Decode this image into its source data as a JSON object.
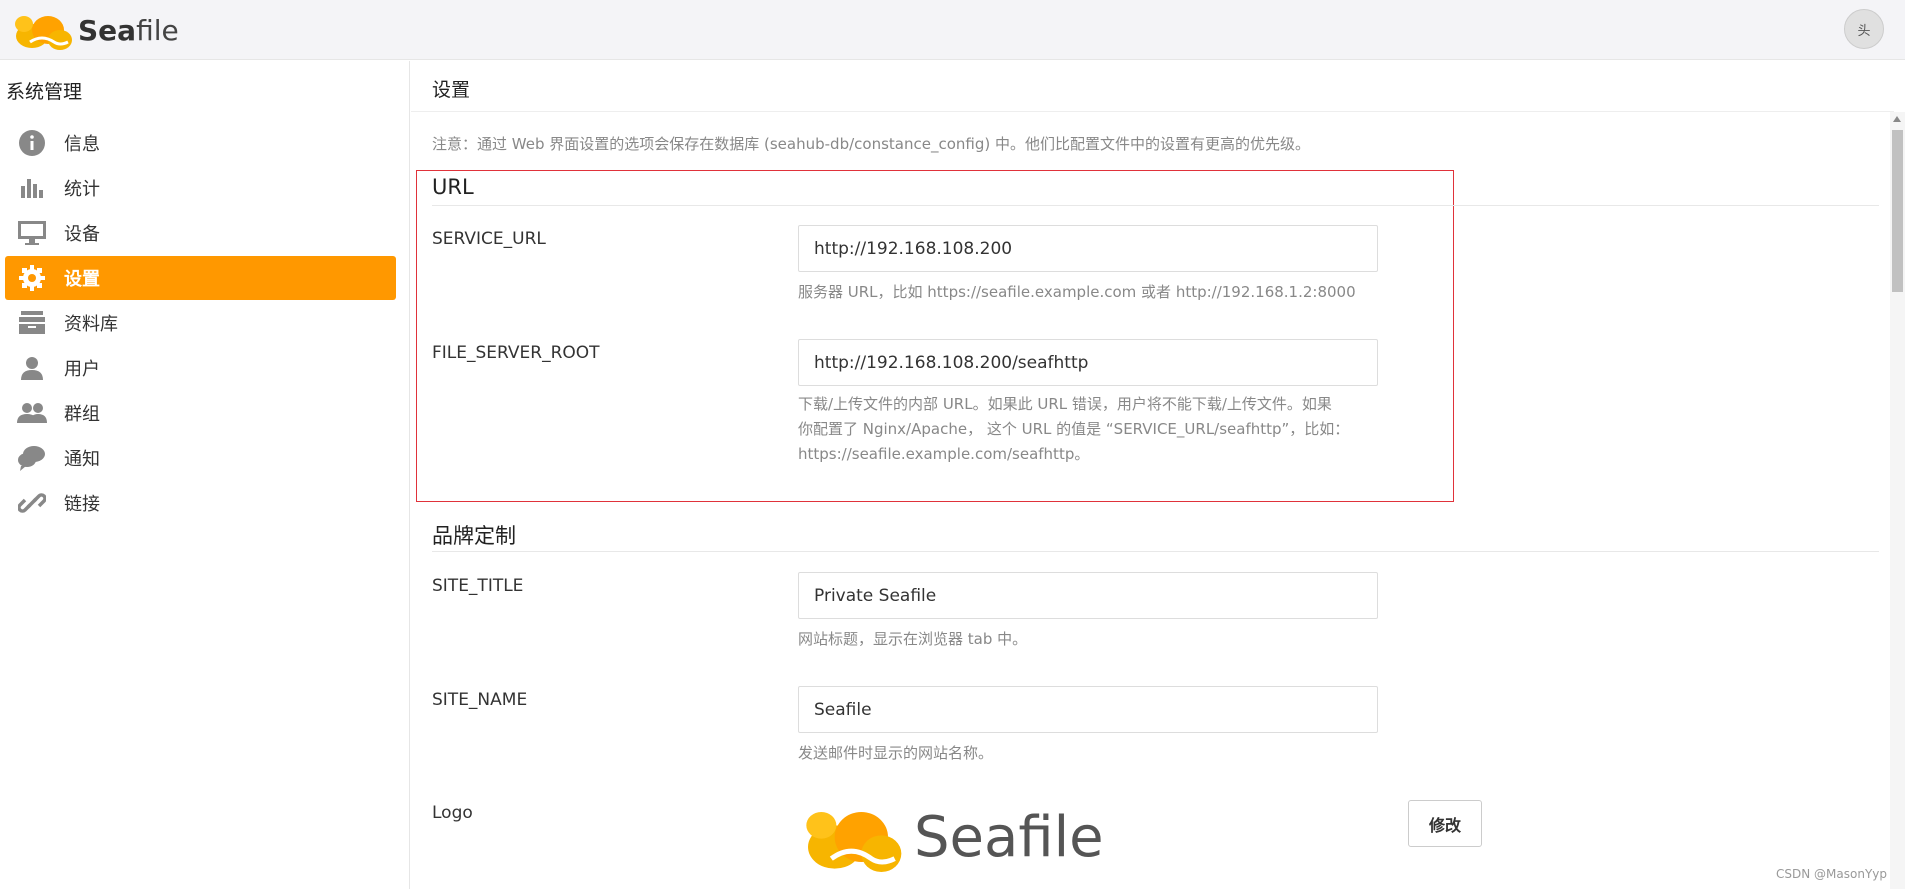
{
  "header": {
    "logo_text_bold": "Sea",
    "logo_text_rest": "file",
    "avatar_alt": "头"
  },
  "sidebar": {
    "heading": "系统管理",
    "items": [
      {
        "label": "信息",
        "icon": "info-icon"
      },
      {
        "label": "统计",
        "icon": "bar-chart-icon"
      },
      {
        "label": "设备",
        "icon": "monitor-icon"
      },
      {
        "label": "设置",
        "icon": "gear-icon",
        "active": true
      },
      {
        "label": "资料库",
        "icon": "archive-icon"
      },
      {
        "label": "用户",
        "icon": "user-icon"
      },
      {
        "label": "群组",
        "icon": "group-icon"
      },
      {
        "label": "通知",
        "icon": "chat-icon"
      },
      {
        "label": "链接",
        "icon": "link-icon"
      }
    ]
  },
  "main": {
    "title": "设置",
    "note": "注意：通过 Web 界面设置的选项会保存在数据库 (seahub-db/constance_config) 中。他们比配置文件中的设置有更高的优先级。",
    "sections": {
      "url": {
        "title": "URL",
        "service_url": {
          "label": "SERVICE_URL",
          "value": "http://192.168.108.200",
          "help": "服务器 URL，比如 https://seafile.example.com 或者 http://192.168.1.2:8000"
        },
        "file_server_root": {
          "label": "FILE_SERVER_ROOT",
          "value": "http://192.168.108.200/seafhttp",
          "help_line1": "下载/上传文件的内部 URL。如果此 URL 错误，用户将不能下载/上传文件。如果",
          "help_line2": "你配置了 Nginx/Apache， 这个 URL 的值是 “SERVICE_URL/seafhttp”，比如：",
          "help_line3": "https://seafile.example.com/seafhttp。"
        }
      },
      "branding": {
        "title": "品牌定制",
        "site_title": {
          "label": "SITE_TITLE",
          "value": "Private Seafile",
          "help": "网站标题，显示在浏览器 tab 中。"
        },
        "site_name": {
          "label": "SITE_NAME",
          "value": "Seafile",
          "help": "发送邮件时显示的网站名称。"
        },
        "logo": {
          "label": "Logo",
          "preview_text": "Seafile",
          "modify_label": "修改"
        }
      }
    }
  },
  "watermark": "CSDN @MasonYyp",
  "colors": {
    "accent": "#ff9800",
    "highlight_border": "#e0323a"
  }
}
